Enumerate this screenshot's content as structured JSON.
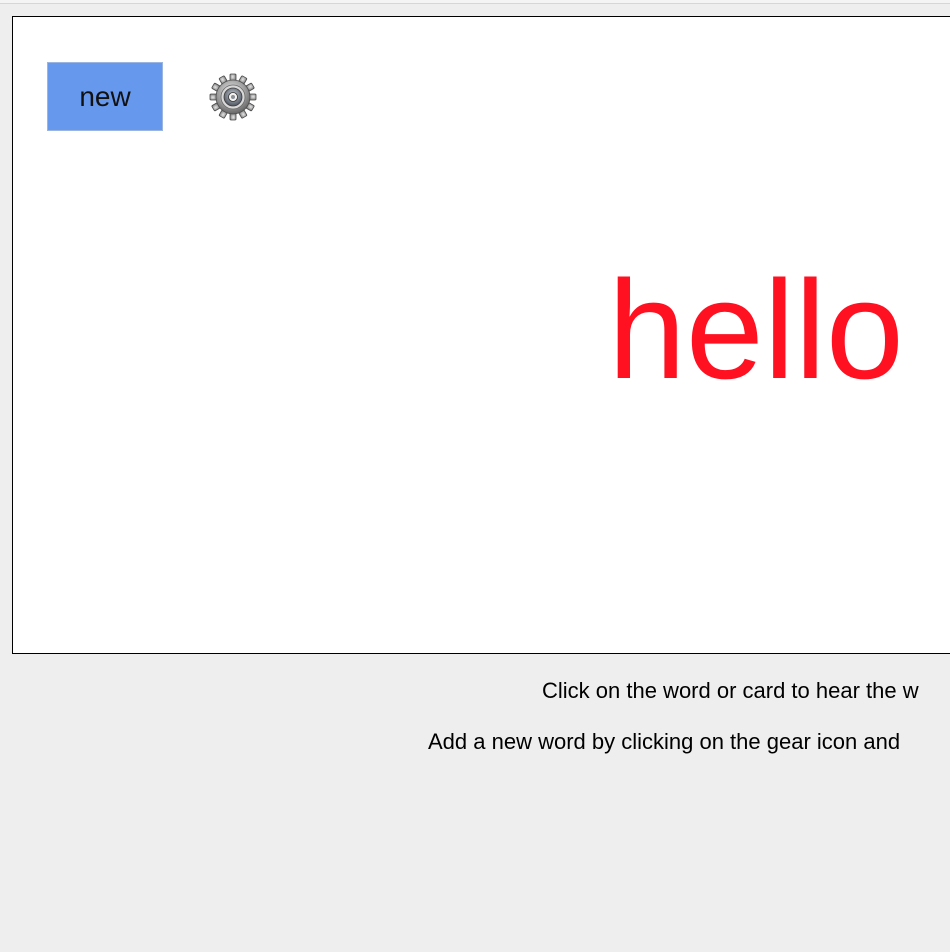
{
  "toolbar": {
    "new_label": "new",
    "settings_icon": "gear-icon"
  },
  "card": {
    "word": "hello",
    "word_color": "#ff1122"
  },
  "instructions": [
    "Click on the word or card to hear the w",
    "Add a new word by clicking on the gear icon and"
  ],
  "colors": {
    "button_bg": "#6699ee",
    "page_bg": "#eeeeee",
    "card_bg": "#ffffff"
  }
}
